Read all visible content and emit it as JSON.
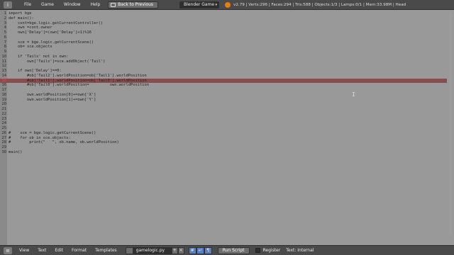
{
  "topbar": {
    "menus": [
      "File",
      "Game",
      "Window",
      "Help"
    ],
    "back_button": "Back to Previous",
    "engine": "Blender Game",
    "stats": "v2.79 | Verts:296 | Faces:294 | Tris:588 | Objects:1/3 | Lamps:0/1 | Mem:33.98M | Head"
  },
  "editor": {
    "lines": [
      {
        "n": "1",
        "text": "import bge"
      },
      {
        "n": "2",
        "text": "def main():"
      },
      {
        "n": "3",
        "text": "    cont=bge.logic.getCurrentController()"
      },
      {
        "n": "4",
        "text": "    own =cont.owner"
      },
      {
        "n": "5",
        "text": "    own['Delay']=(own['Delay']+1)%16"
      },
      {
        "n": "6",
        "text": ""
      },
      {
        "n": "7",
        "text": "    sce = bge.logic.getCurrentScene()"
      },
      {
        "n": "8",
        "text": "    ob= sce.objects"
      },
      {
        "n": "9",
        "text": ""
      },
      {
        "n": "10",
        "text": "    if 'Tails' not in own:"
      },
      {
        "n": "11",
        "text": "        own['Tails']=sce.addObject('Tail')"
      },
      {
        "n": "12",
        "text": ""
      },
      {
        "n": "13",
        "text": "    if own['Delay']==0:"
      },
      {
        "n": "14",
        "text": "        #ob['Tail2'].worldPosition=ob['Tail1'].worldPosition"
      },
      {
        "n": "15",
        "text": "        #ob['Tail1'].worldPosition=ob['Tail0'].worldPosition"
      },
      {
        "n": "16",
        "text": "        #ob['Tail0'].worldPosition=         own.worldPosition"
      },
      {
        "n": "17",
        "text": ""
      },
      {
        "n": "18",
        "text": "        own.worldPosition[0]+=own['X']"
      },
      {
        "n": "19",
        "text": "        own.worldPosition[1]+=own['Y']"
      },
      {
        "n": "20",
        "text": ""
      },
      {
        "n": "21",
        "text": ""
      },
      {
        "n": "22",
        "text": ""
      },
      {
        "n": "23",
        "text": ""
      },
      {
        "n": "24",
        "text": ""
      },
      {
        "n": "25",
        "text": ""
      },
      {
        "n": "26",
        "text": "#    sce = bge.logic.getCurrentScene()"
      },
      {
        "n": "27",
        "text": "#    for ob in sce.objects:"
      },
      {
        "n": "28",
        "text": "#        print(\"   \", ob.name, ob.worldPosition)"
      },
      {
        "n": "29",
        "text": ""
      },
      {
        "n": "30",
        "text": "main()"
      }
    ],
    "error_line": "15"
  },
  "bottombar": {
    "menus": [
      "View",
      "Text",
      "Edit",
      "Format",
      "Templates"
    ],
    "filename": "gamelogic.py",
    "run_script": "Run Script",
    "register": "Register",
    "text_internal": "Text: Internal"
  },
  "colors": {
    "header": "#4a4a4a",
    "editor_bg": "#999999",
    "error_highlight": "#8a4d4d",
    "accent": "#5680c2"
  }
}
